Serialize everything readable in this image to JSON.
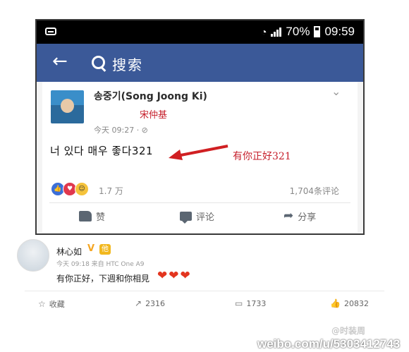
{
  "status_bar": {
    "battery": "70%",
    "time": "09:59"
  },
  "fb_header": {
    "search_label": "搜索"
  },
  "post": {
    "author": "송중기(Song Joong Ki)",
    "author_zh_annotation": "宋仲基",
    "meta": "今天 09:27 · ⊘",
    "text": "너 있다 매우 좋다321",
    "annotation": "有你正好321",
    "reactions_count": "1.7 万",
    "comments_count": "1,704条评论",
    "actions": {
      "like": "赞",
      "comment": "评论",
      "share": "分享"
    }
  },
  "weibo_comment": {
    "user": "林心如",
    "verified_mark": "V",
    "badge": "他",
    "meta": "今天 09:18 来自 HTC One A9",
    "text": "有你正好，下週和你相見",
    "actions": {
      "favorite": "收藏",
      "repost": "2316",
      "comment": "1733",
      "like": "20832"
    }
  },
  "watermark": {
    "sub": "@时装周",
    "main": "weibo.com/u/5303412743"
  },
  "colors": {
    "fb_blue": "#3b5998",
    "annotation_red": "#c61f2b",
    "heart": "#e3351f"
  }
}
